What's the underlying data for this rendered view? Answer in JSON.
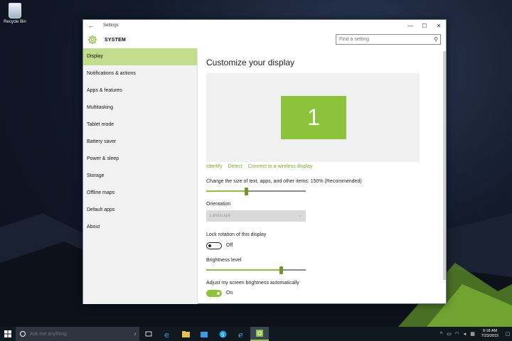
{
  "desktop": {
    "recycle_bin_label": "Recycle Bin"
  },
  "window": {
    "title": "Settings",
    "back_glyph": "←",
    "minimize_glyph": "—",
    "maximize_glyph": "☐",
    "close_glyph": "✕"
  },
  "header": {
    "section_title": "SYSTEM",
    "search_placeholder": "Find a setting",
    "search_value": ""
  },
  "sidebar": {
    "items": [
      {
        "label": "Display",
        "active": true
      },
      {
        "label": "Notifications & actions"
      },
      {
        "label": "Apps & features"
      },
      {
        "label": "Multitasking"
      },
      {
        "label": "Tablet mode"
      },
      {
        "label": "Battery saver"
      },
      {
        "label": "Power & sleep"
      },
      {
        "label": "Storage"
      },
      {
        "label": "Offline maps"
      },
      {
        "label": "Default apps"
      },
      {
        "label": "About"
      }
    ]
  },
  "main": {
    "heading": "Customize your display",
    "monitor_number": "1",
    "links": {
      "identify": "Identify",
      "detect": "Detect",
      "wireless": "Connect to a wireless display"
    },
    "scale_label": "Change the size of text, apps, and other items: 150% (Recommended)",
    "scale_level": 0.4,
    "orientation_label": "Orientation",
    "orientation_value": "Landscape",
    "lock_rotation_label": "Lock rotation of this display",
    "lock_rotation_state": "Off",
    "brightness_label": "Brightness level",
    "brightness_level": 0.75,
    "auto_brightness_label": "Adjust my screen brightness automatically",
    "auto_brightness_state": "On"
  },
  "taskbar": {
    "search_placeholder": "Ask me anything",
    "time": "9:18 AM",
    "date": "7/23/2015"
  },
  "colors": {
    "accent": "#8bc33a",
    "accent_dark": "#6e9a25",
    "sidebar_active": "#c2dd8b",
    "link": "#7bab2a",
    "taskbar": "#101820"
  }
}
